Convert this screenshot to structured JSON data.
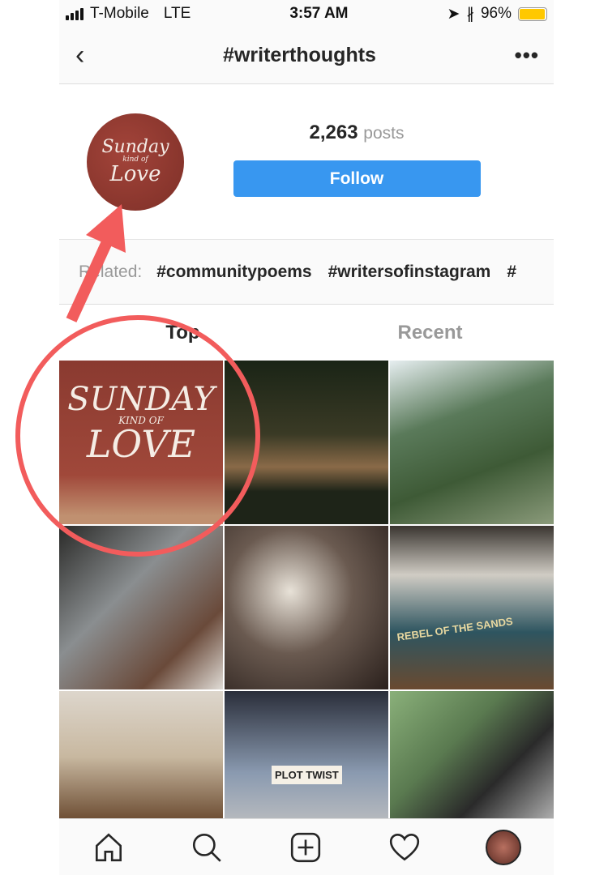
{
  "status_bar": {
    "carrier": "T-Mobile",
    "network": "LTE",
    "time": "3:57 AM",
    "battery": "96%",
    "battery_level": 0.96,
    "battery_color": "#ffc800"
  },
  "nav": {
    "title": "#writerthoughts",
    "back_icon": "chevron-left-icon",
    "more_icon": "more-horizontal-icon"
  },
  "profile": {
    "posts_count": "2,263",
    "posts_label": "posts",
    "follow_label": "Follow",
    "follow_color": "#3897f0",
    "avatar_logo_text": "Sunday Kind of Love"
  },
  "related": {
    "label": "Related:",
    "tags": [
      "#communitypoems",
      "#writersofinstagram",
      "#"
    ]
  },
  "tabs": [
    {
      "label": "Top",
      "active": true
    },
    {
      "label": "Recent",
      "active": false
    }
  ],
  "grid": {
    "sunday_logo": [
      "SUNDAY",
      "KIND OF",
      "LOVE"
    ],
    "plot_twist_label": "PLOT TWIST",
    "rebel_label": "REBEL OF THE SANDS"
  },
  "bottom_nav": [
    "home-icon",
    "search-icon",
    "add-post-icon",
    "heart-icon",
    "profile-avatar"
  ],
  "annotation": {
    "color": "#f25c5c"
  }
}
